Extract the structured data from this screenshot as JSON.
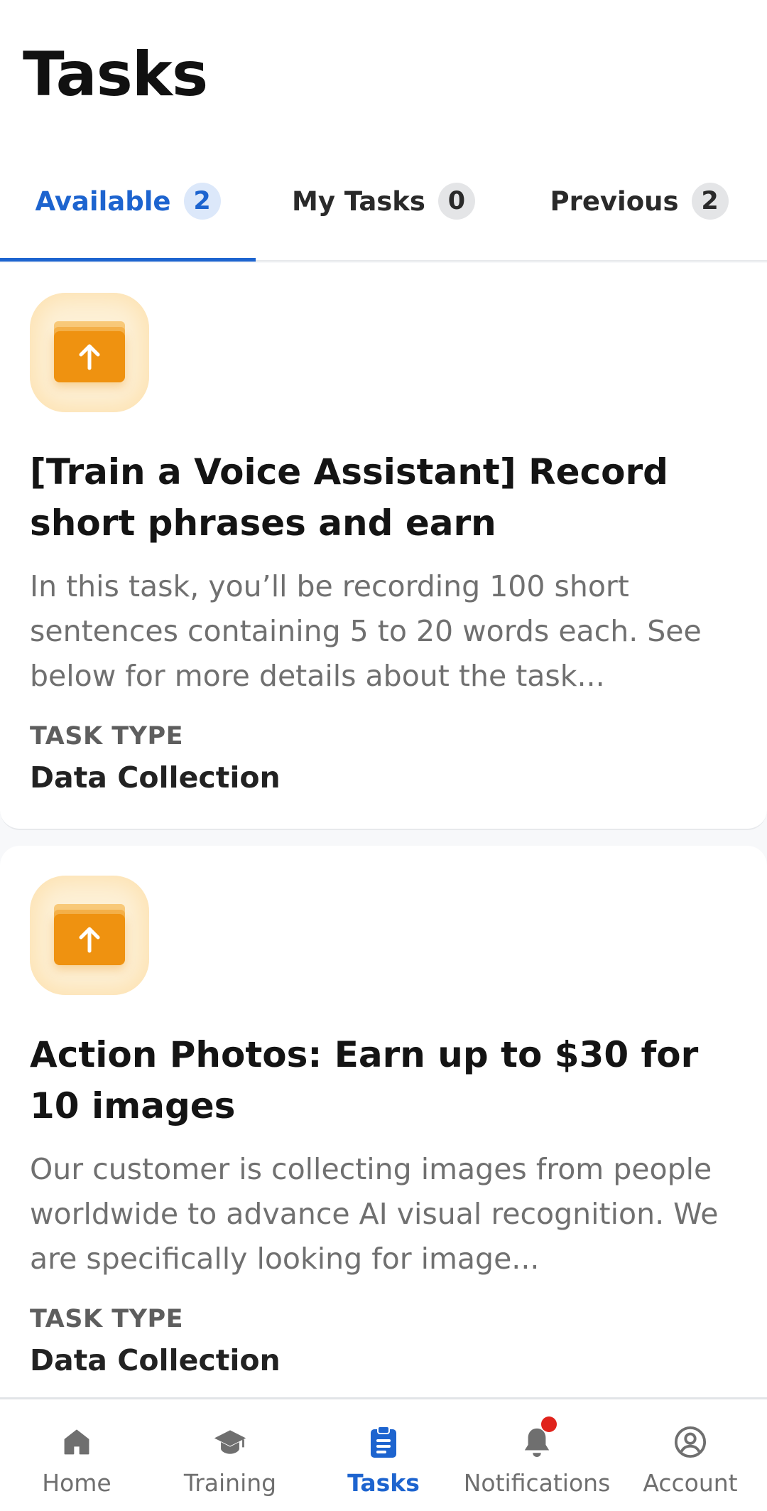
{
  "header": {
    "title": "Tasks"
  },
  "tabs": [
    {
      "label": "Available",
      "count": "2",
      "active": true
    },
    {
      "label": "My Tasks",
      "count": "0",
      "active": false
    },
    {
      "label": "Previous",
      "count": "2",
      "active": false
    }
  ],
  "tasks": [
    {
      "icon": "upload-tray-icon",
      "title": "[Train a Voice Assistant] Record short phrases and earn",
      "description": "In this task, you’ll be recording 100 short sentences containing 5 to 20 words each. See below for more details about the task...",
      "type_label": "TASK TYPE",
      "type_value": "Data Collection"
    },
    {
      "icon": "upload-tray-icon",
      "title": "Action Photos: Earn up to $30 for 10 images",
      "description": "Our customer is collecting images from people worldwide to advance AI visual recognition. We are specifically looking for image...",
      "type_label": "TASK TYPE",
      "type_value": "Data Collection"
    }
  ],
  "bottom_nav": [
    {
      "label": "Home",
      "icon": "home-icon"
    },
    {
      "label": "Training",
      "icon": "graduation-cap-icon"
    },
    {
      "label": "Tasks",
      "icon": "clipboard-list-icon",
      "active": true
    },
    {
      "label": "Notifications",
      "icon": "bell-icon",
      "has_unread": true
    },
    {
      "label": "Account",
      "icon": "account-circle-icon"
    }
  ],
  "colors": {
    "accent": "#1d64cf",
    "icon_orange": "#ef9210",
    "notification_dot": "#e0231c"
  }
}
